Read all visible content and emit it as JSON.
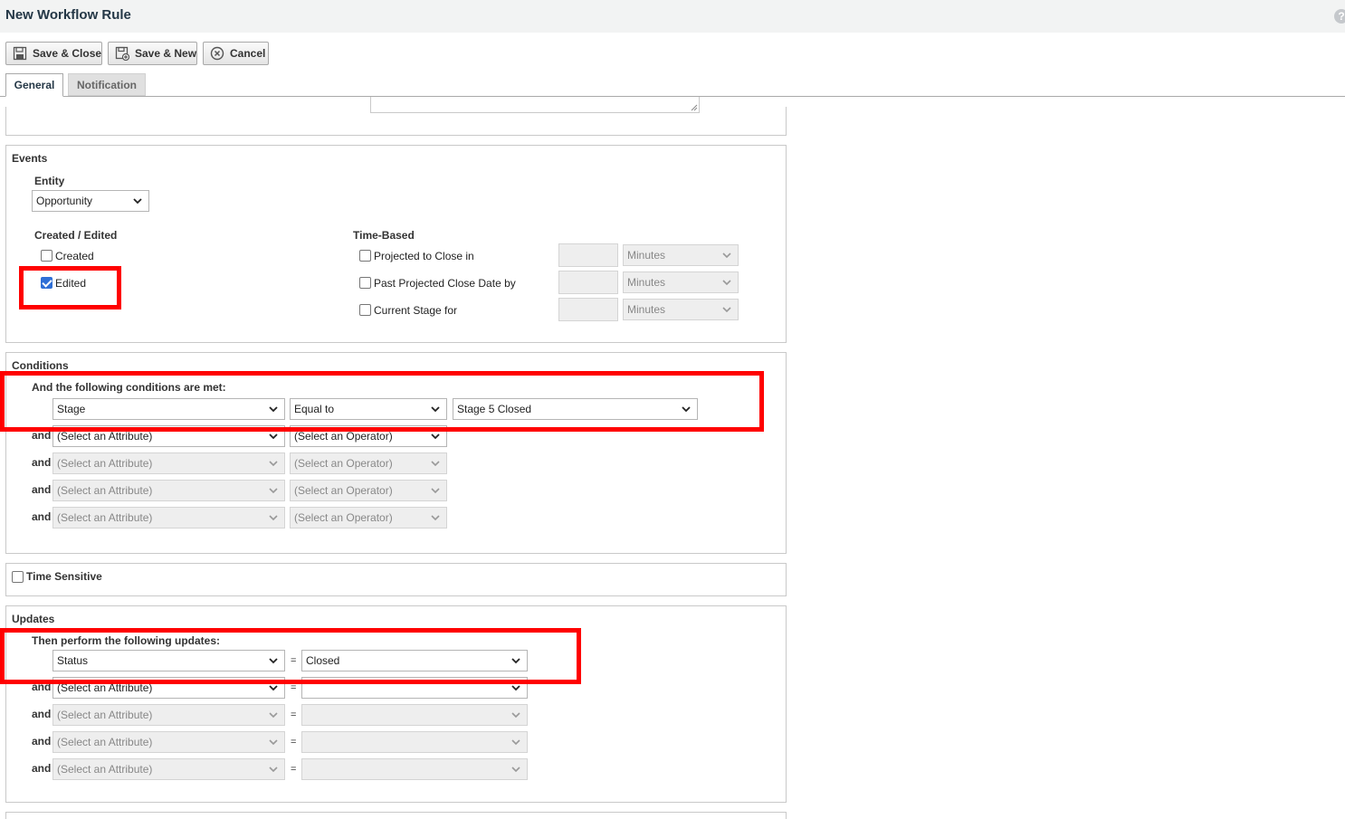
{
  "window": {
    "title": "New Workflow Rule",
    "help_glyph": "?"
  },
  "toolbar": {
    "save_close_label": "Save & Close",
    "save_new_label": "Save & New",
    "cancel_label": "Cancel"
  },
  "tabs": [
    {
      "label": "General",
      "active": true
    },
    {
      "label": "Notification",
      "active": false
    }
  ],
  "events": {
    "section_title": "Events",
    "entity_label": "Entity",
    "entity_value": "Opportunity",
    "created_edited_label": "Created / Edited",
    "created": {
      "label": "Created",
      "checked": false
    },
    "edited": {
      "label": "Edited",
      "checked": true
    },
    "time_based_label": "Time-Based",
    "time_based": [
      {
        "label": "Projected to Close in",
        "checked": false,
        "value": "",
        "unit": "Minutes"
      },
      {
        "label": "Past Projected Close Date by",
        "checked": false,
        "value": "",
        "unit": "Minutes"
      },
      {
        "label": "Current Stage for",
        "checked": false,
        "value": "",
        "unit": "Minutes"
      }
    ]
  },
  "conditions": {
    "section_title": "Conditions",
    "intro": "And the following conditions are met:",
    "first": {
      "attribute": "Stage",
      "operator": "Equal to",
      "value": "Stage 5 Closed"
    },
    "and_label": "and",
    "rows": [
      {
        "attribute": "(Select an Attribute)",
        "operator": "(Select an Operator)"
      },
      {
        "attribute": "(Select an Attribute)",
        "operator": "(Select an Operator)"
      },
      {
        "attribute": "(Select an Attribute)",
        "operator": "(Select an Operator)"
      },
      {
        "attribute": "(Select an Attribute)",
        "operator": "(Select an Operator)"
      }
    ]
  },
  "time_sensitive": {
    "label": "Time Sensitive",
    "checked": false
  },
  "updates": {
    "section_title": "Updates",
    "intro": "Then perform the following updates:",
    "first": {
      "attribute": "Status",
      "value": "Closed"
    },
    "and_label": "and",
    "equals": "=",
    "rows": [
      {
        "attribute": "(Select an Attribute)",
        "value": ""
      },
      {
        "attribute": "(Select an Attribute)",
        "value": ""
      },
      {
        "attribute": "(Select an Attribute)",
        "value": ""
      },
      {
        "attribute": "(Select an Attribute)",
        "value": ""
      }
    ]
  },
  "colors": {
    "highlight": "#ff0000",
    "title_text": "#243746",
    "checkbox_checked": "#2f6fd6"
  },
  "icons": [
    "save-icon",
    "save-new-icon",
    "cancel-icon",
    "help-icon",
    "chevron-down-icon"
  ]
}
